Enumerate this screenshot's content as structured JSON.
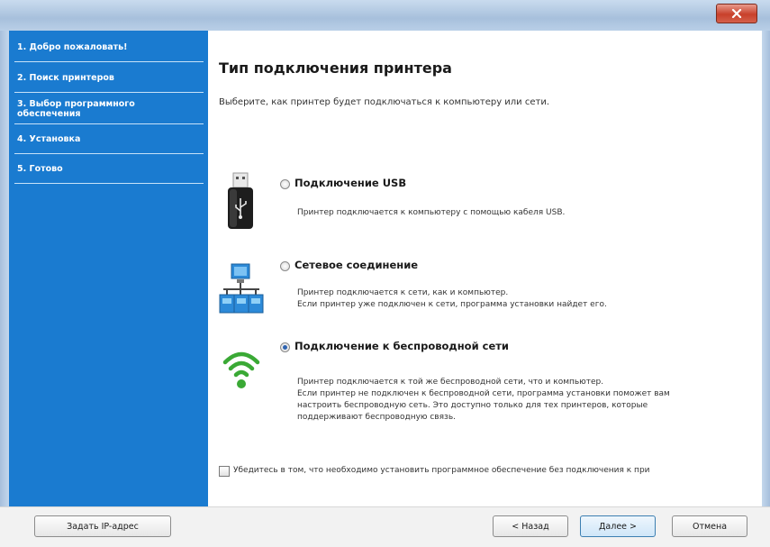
{
  "window": {
    "title": "",
    "close_icon": "close-icon"
  },
  "sidebar": {
    "color": "#1a7bd0",
    "steps": [
      {
        "label": "1. Добро пожаловать!"
      },
      {
        "label": "2. Поиск принтеров"
      },
      {
        "label": "3. Выбор программного обеспечения"
      },
      {
        "label": "4. Установка"
      },
      {
        "label": "5. Готово"
      }
    ]
  },
  "main": {
    "heading": "Тип подключения принтера",
    "subtitle": "Выберите, как принтер будет подключаться к компьютеру или сети.",
    "options": [
      {
        "title": "Подключение USB",
        "desc": [
          "Принтер подключается к компьютеру с помощью кабеля USB."
        ],
        "selected": false,
        "icon": "usb-icon"
      },
      {
        "title": "Сетевое соединение",
        "desc": [
          "Принтер подключается к сети, как и компьютер.",
          "Если принтер уже подключен к сети, программа установки найдет его."
        ],
        "selected": false,
        "icon": "network-icon"
      },
      {
        "title": "Подключение к беспроводной сети",
        "desc": [
          "Принтер подключается к той же беспроводной сети, что и компьютер.",
          "Если принтер не подключен к беспроводной сети, программа установки поможет вам",
          "настроить беспроводную сеть. Это доступно только для тех принтеров, которые",
          "поддерживают беспроводную связь."
        ],
        "selected": true,
        "icon": "wifi-icon"
      }
    ],
    "checkbox": {
      "label": "Убедитесь в том, что необходимо установить программное обеспечение без подключения к при",
      "checked": false
    }
  },
  "footer": {
    "ip_button": "Задать IP-адрес",
    "back_button": "< Назад",
    "next_button": "Далее >",
    "cancel_button": "Отмена"
  },
  "colors": {
    "accent": "#1a7bd0",
    "wifi_green": "#3aa935",
    "close_red": "#c8402b"
  }
}
